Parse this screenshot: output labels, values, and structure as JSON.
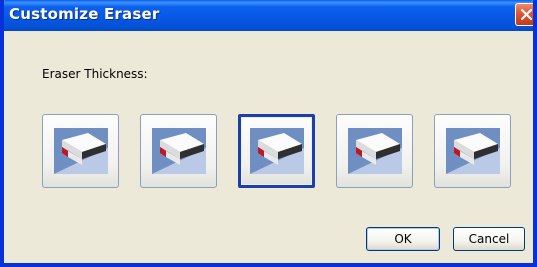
{
  "window": {
    "title": "Customize Eraser",
    "close_icon": "close-icon"
  },
  "content": {
    "thickness_label": "Eraser Thickness:",
    "options": [
      {
        "icon": "eraser-icon",
        "selected": false
      },
      {
        "icon": "eraser-icon",
        "selected": false
      },
      {
        "icon": "eraser-icon",
        "selected": true
      },
      {
        "icon": "eraser-icon",
        "selected": false
      },
      {
        "icon": "eraser-icon",
        "selected": false
      }
    ]
  },
  "buttons": {
    "ok_label": "OK",
    "cancel_label": "Cancel"
  },
  "colors": {
    "titlebar": "#0858e6",
    "dialog_bg": "#ece9d8",
    "selection_border": "#1f3fa8",
    "close_button": "#e05532"
  }
}
